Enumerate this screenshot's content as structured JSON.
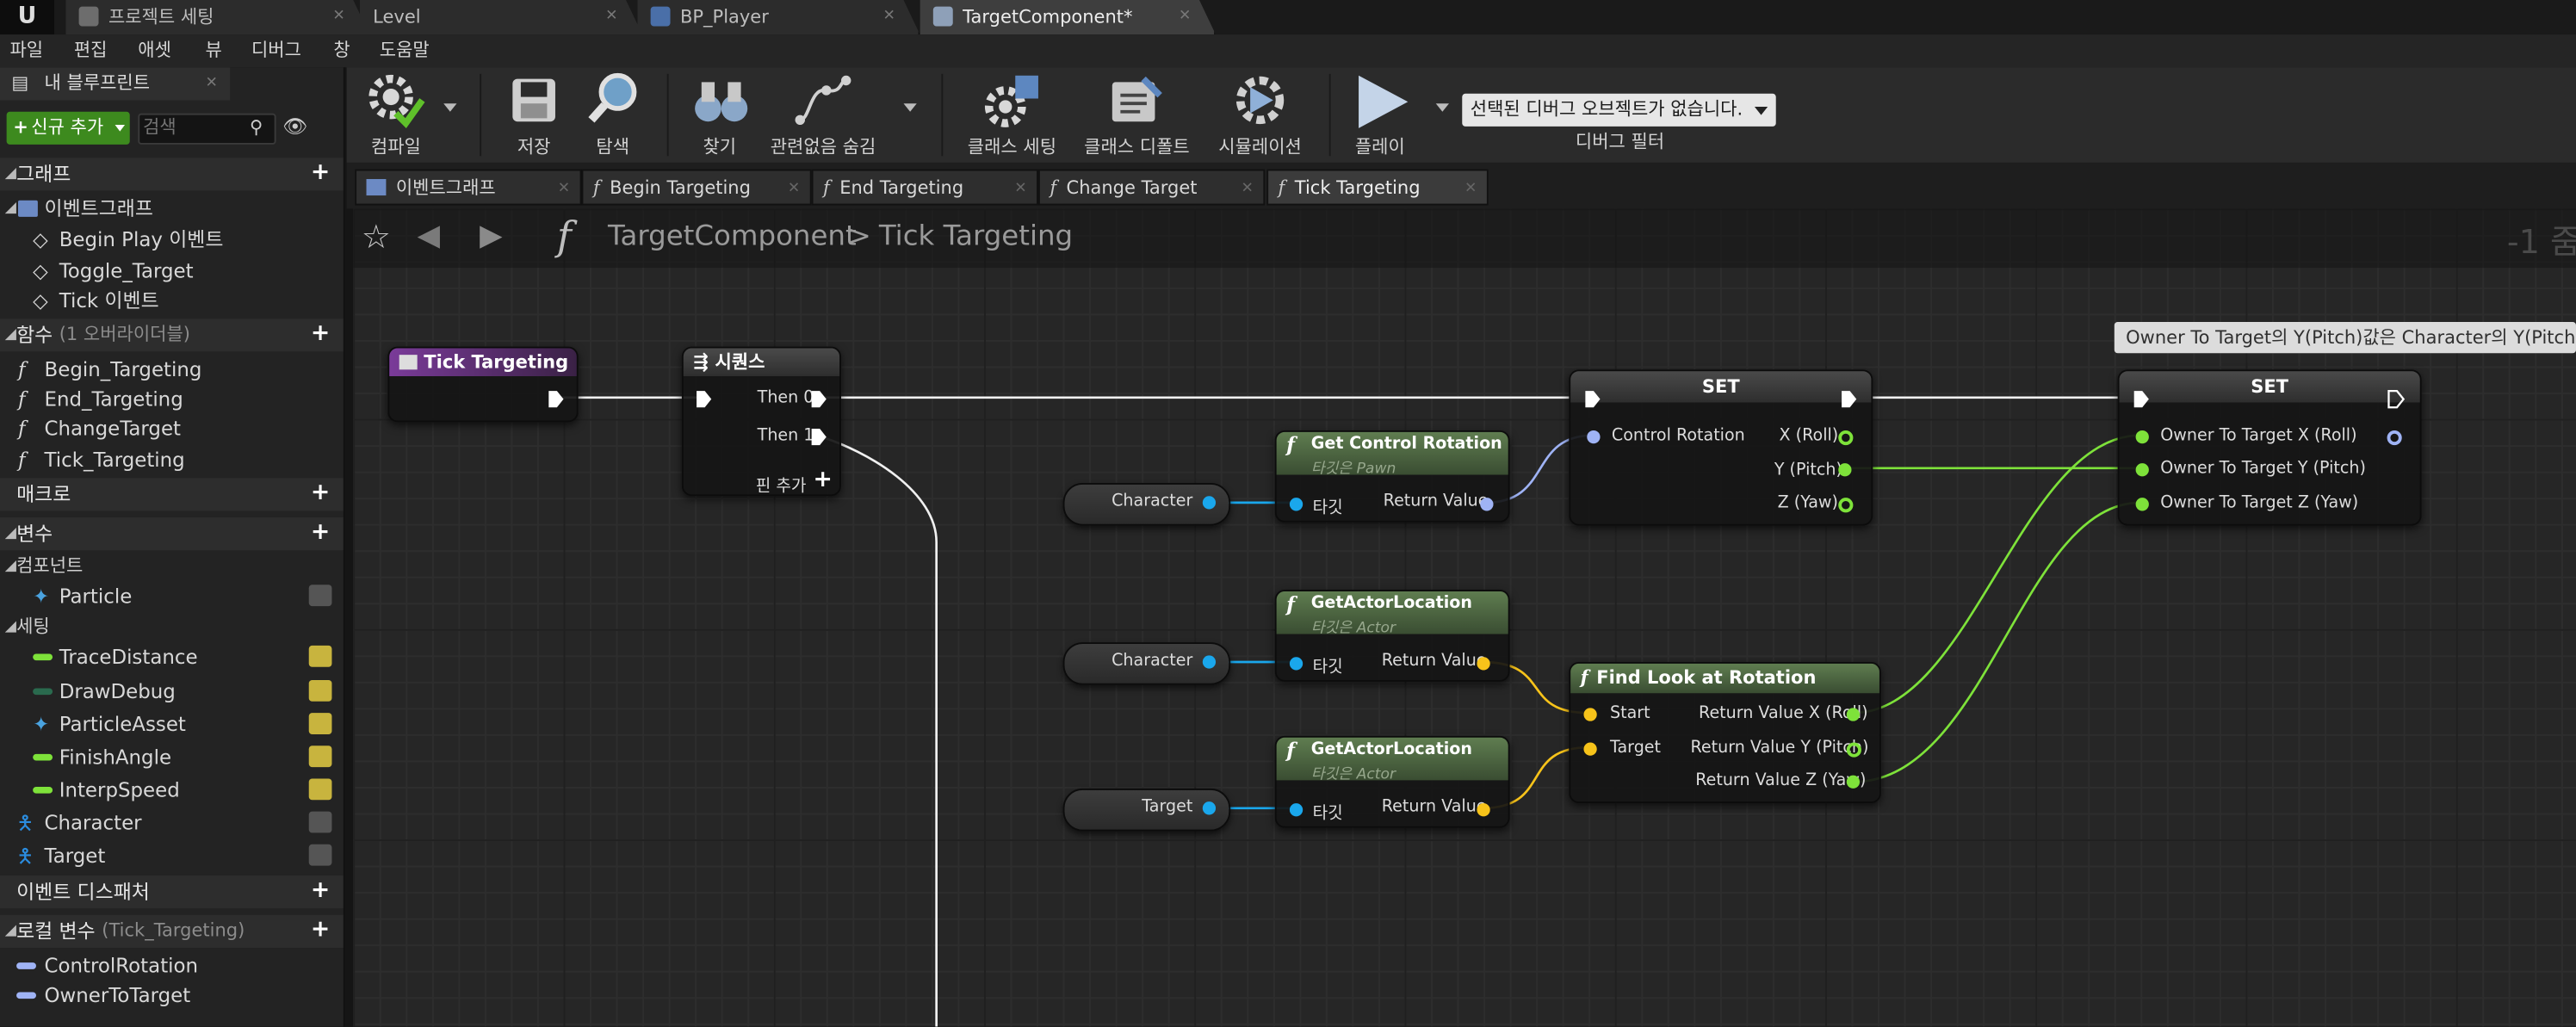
{
  "app": {
    "logo": "U"
  },
  "tabs": [
    {
      "label": "프로젝트 세팅"
    },
    {
      "label": "Level"
    },
    {
      "label": "BP_Player"
    },
    {
      "label": "TargetComponent*"
    }
  ],
  "menu": [
    "파일",
    "편집",
    "애셋",
    "뷰",
    "디버그",
    "창",
    "도움말"
  ],
  "left_panel": {
    "tab_title": "내 블루프린트",
    "add_new_label": "신규 추가",
    "search_placeholder": "검색",
    "graph_section": "그래프",
    "event_graph": "이벤트그래프",
    "events": [
      "Begin Play 이벤트",
      "Toggle_Target",
      "Tick 이벤트"
    ],
    "functions_section": "함수",
    "functions_note": "(1 오버라이더블)",
    "functions": [
      "Begin_Targeting",
      "End_Targeting",
      "ChangeTarget",
      "Tick_Targeting"
    ],
    "macros_section": "매크로",
    "variables_section": "변수",
    "components_cat": "컴포넌트",
    "component_vars": [
      "Particle"
    ],
    "settings_cat": "세팅",
    "setting_vars": [
      "TraceDistance",
      "DrawDebug",
      "ParticleAsset",
      "FinishAngle",
      "InterpSpeed"
    ],
    "other_vars": [
      "Character",
      "Target"
    ],
    "dispatchers_section": "이벤트 디스패처",
    "local_vars_section": "로컬 변수",
    "local_vars_note": "(Tick_Targeting)",
    "local_vars": [
      "ControlRotation",
      "OwnerToTarget"
    ]
  },
  "toolbar": {
    "compile": "컴파일",
    "save": "저장",
    "browse": "탐색",
    "find": "찾기",
    "hide_unrelated": "관련없음 숨김",
    "class_settings": "클래스 세팅",
    "class_defaults": "클래스 디폴트",
    "simulation": "시뮬레이션",
    "play": "플레이",
    "debug_select": "선택된 디버그 오브젝트가 없습니다.",
    "debug_filter": "디버그 필터"
  },
  "doc_tabs": [
    "이벤트그래프",
    "Begin Targeting",
    "End Targeting",
    "Change Target",
    "Tick Targeting"
  ],
  "breadcrumb": {
    "class": "TargetComponent",
    "separator": ">",
    "function": "Tick Targeting",
    "zoom": "-1 줌"
  },
  "graph": {
    "tooltip": "Owner To Target의 Y(Pitch)값은 Character의 Y(Pitch)값",
    "entry": {
      "title": "Tick Targeting"
    },
    "sequence": {
      "title": "시퀀스",
      "then0": "Then 0",
      "then1": "Then 1",
      "add_pin": "핀 추가"
    },
    "get_control_rotation": {
      "title": "Get Control Rotation",
      "subtitle": "타깃은 Pawn",
      "target": "타깃",
      "ret": "Return Value"
    },
    "get_actor_location_1": {
      "title": "GetActorLocation",
      "subtitle": "타깃은 Actor",
      "target": "타깃",
      "ret": "Return Value"
    },
    "get_actor_location_2": {
      "title": "GetActorLocation",
      "subtitle": "타깃은 Actor",
      "target": "타깃",
      "ret": "Return Value"
    },
    "var_character_1": "Character",
    "var_character_2": "Character",
    "var_target": "Target",
    "set1": {
      "title": "SET",
      "in": "Control Rotation",
      "x": "X (Roll)",
      "y": "Y (Pitch)",
      "z": "Z (Yaw)"
    },
    "find_look": {
      "title": "Find Look at Rotation",
      "start": "Start",
      "target": "Target",
      "rx": "Return Value X (Roll)",
      "ry": "Return Value Y (Pitch)",
      "rz": "Return Value Z (Yaw)"
    },
    "set2": {
      "title": "SET",
      "x": "Owner To Target X (Roll)",
      "y": "Owner To Target Y (Pitch)",
      "z": "Owner To Target Z (Yaw)"
    }
  },
  "colors": {
    "exec": "#ffffff",
    "object": "#1aa7ec",
    "vector": "#f7c31a",
    "rotator": "#9fb3f5",
    "float": "#7ee23a",
    "function_header": "#5d7a4e",
    "entry_header": "#6f3d8c"
  }
}
